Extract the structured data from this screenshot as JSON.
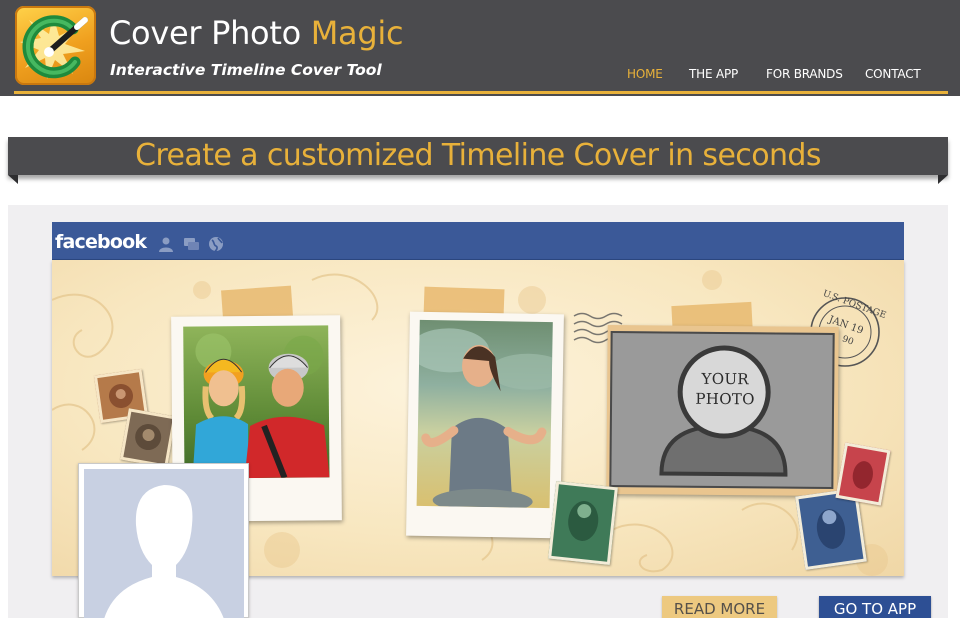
{
  "brand": {
    "title_main": "Cover Photo ",
    "title_accent": "Magic",
    "tagline": "Interactive Timeline Cover Tool",
    "icon": "magic-wand-icon"
  },
  "nav": {
    "items": [
      {
        "label": "HOME",
        "active": true
      },
      {
        "label": "THE APP",
        "active": false
      },
      {
        "label": "FOR BRANDS",
        "active": false
      },
      {
        "label": "CONTACT",
        "active": false
      }
    ]
  },
  "banner": {
    "headline": "Create a customized Timeline Cover in seconds"
  },
  "facebook": {
    "logo": "facebook",
    "icons": [
      "friends-icon",
      "messages-icon",
      "globe-icon"
    ]
  },
  "cover": {
    "placeholder_line1": "YOUR",
    "placeholder_line2": "PHOTO",
    "postmark_line1": "U.S. POSTAGE",
    "postmark_line2": "JAN 19",
    "postmark_line3": "90"
  },
  "buttons": {
    "read_more": "READ MORE",
    "go_to_app": "GO TO APP"
  },
  "colors": {
    "header_bg": "#4b4b4e",
    "accent": "#e8b13a",
    "facebook_blue": "#3b5998",
    "go_button": "#2d4f94",
    "read_button": "#edc980"
  }
}
